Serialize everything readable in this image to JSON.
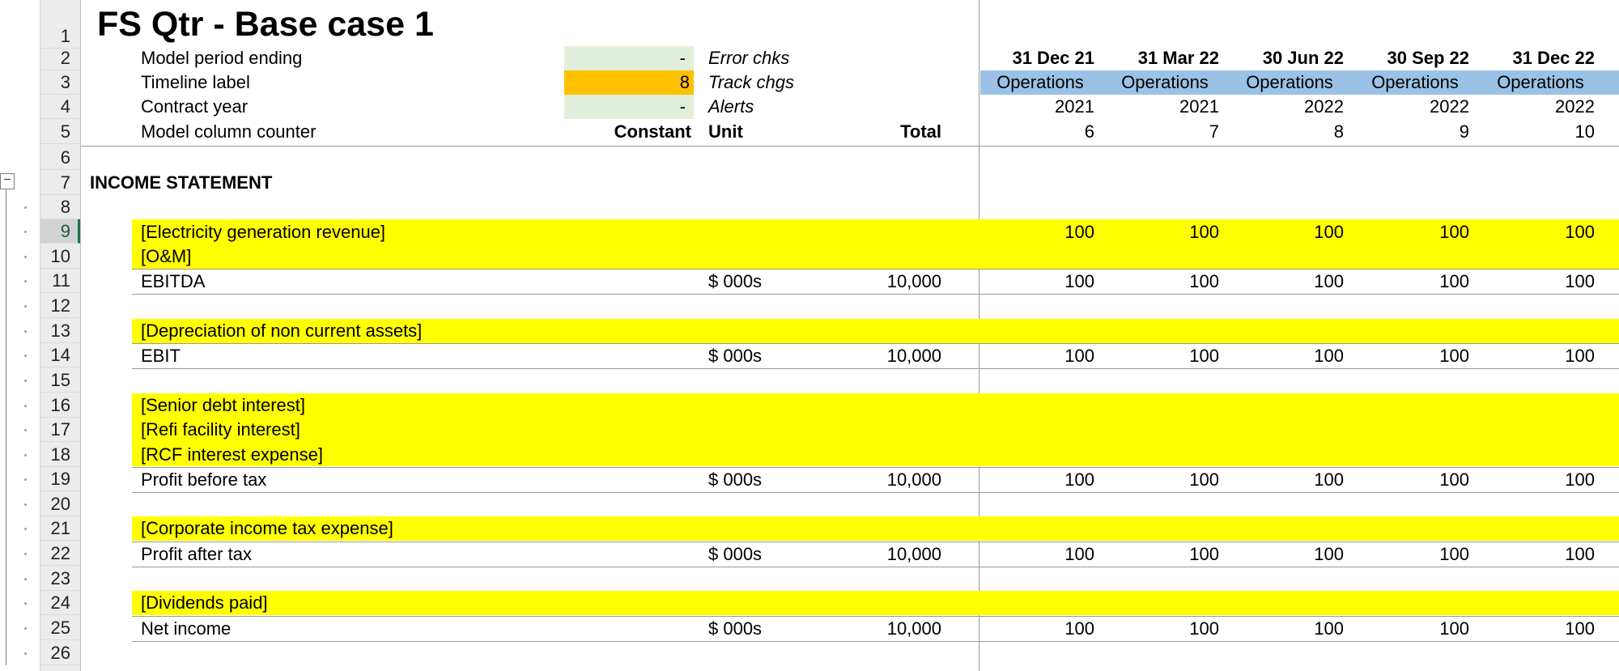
{
  "sheet": {
    "title": "FS Qtr - Base case 1",
    "row_numbers": [
      "1",
      "2",
      "3",
      "4",
      "5",
      "6",
      "7",
      "8",
      "9",
      "10",
      "11",
      "12",
      "13",
      "14",
      "15",
      "16",
      "17",
      "18",
      "19",
      "20",
      "21",
      "22",
      "23",
      "24",
      "25",
      "26"
    ],
    "outline_collapse_symbol": "−"
  },
  "header": {
    "model_period_ending": "Model period ending",
    "timeline_label": "Timeline label",
    "contract_year": "Contract year",
    "model_column_counter": "Model column counter",
    "val_period": "-",
    "val_timeline": "8",
    "val_contract": "-",
    "error_chks": "Error chks",
    "track_chgs": "Track chgs",
    "alerts": "Alerts",
    "constant": "Constant",
    "unit": "Unit",
    "total": "Total"
  },
  "periods": {
    "dates": [
      "31 Dec 21",
      "31 Mar 22",
      "30 Jun 22",
      "30 Sep 22",
      "31 Dec 22"
    ],
    "phase": [
      "Operations",
      "Operations",
      "Operations",
      "Operations",
      "Operations"
    ],
    "years": [
      "2021",
      "2021",
      "2022",
      "2022",
      "2022"
    ],
    "counters": [
      "6",
      "7",
      "8",
      "9",
      "10"
    ]
  },
  "income_statement": {
    "heading": "INCOME STATEMENT",
    "electricity_revenue": {
      "label": "[Electricity generation revenue]",
      "values": [
        "100",
        "100",
        "100",
        "100",
        "100"
      ]
    },
    "om": {
      "label": "[O&M]"
    },
    "ebitda": {
      "label": "EBITDA",
      "unit": "$ 000s",
      "total": "10,000",
      "values": [
        "100",
        "100",
        "100",
        "100",
        "100"
      ]
    },
    "depreciation": {
      "label": "[Depreciation of non current assets]"
    },
    "ebit": {
      "label": "EBIT",
      "unit": "$ 000s",
      "total": "10,000",
      "values": [
        "100",
        "100",
        "100",
        "100",
        "100"
      ]
    },
    "senior_debt_interest": {
      "label": "[Senior debt interest]"
    },
    "refi_interest": {
      "label": "[Refi facility interest]"
    },
    "rcf_interest": {
      "label": "[RCF interest expense]"
    },
    "pbt": {
      "label": "Profit before tax",
      "unit": "$ 000s",
      "total": "10,000",
      "values": [
        "100",
        "100",
        "100",
        "100",
        "100"
      ]
    },
    "tax": {
      "label": "[Corporate income tax expense]"
    },
    "pat": {
      "label": "Profit after tax",
      "unit": "$ 000s",
      "total": "10,000",
      "values": [
        "100",
        "100",
        "100",
        "100",
        "100"
      ]
    },
    "dividends": {
      "label": "[Dividends paid]"
    },
    "net_income": {
      "label": "Net income",
      "unit": "$ 000s",
      "total": "10,000",
      "values": [
        "100",
        "100",
        "100",
        "100",
        "100"
      ]
    }
  },
  "colors": {
    "input_fill": "#ffff00",
    "timeline_fill": "#ffc000",
    "check_fill": "#e2efda",
    "phase_fill": "#9bc2e6",
    "row_header_bg": "#ececec"
  }
}
